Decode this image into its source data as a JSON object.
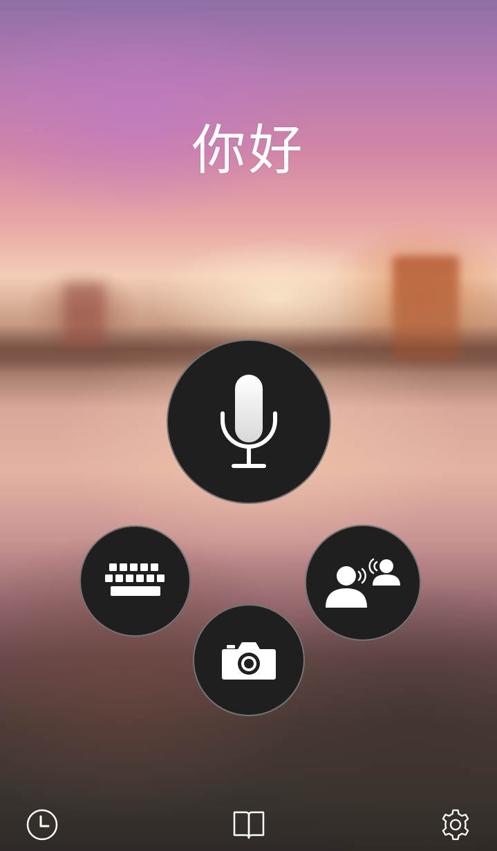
{
  "greeting": {
    "text": "你好"
  },
  "actions": {
    "primary": {
      "name": "microphone",
      "icon": "microphone-icon"
    },
    "secondary": [
      {
        "name": "keyboard",
        "icon": "keyboard-icon"
      },
      {
        "name": "camera",
        "icon": "camera-icon"
      },
      {
        "name": "conversation",
        "icon": "conversation-icon"
      }
    ]
  },
  "bottom_bar": {
    "items": [
      {
        "name": "history",
        "icon": "clock-icon"
      },
      {
        "name": "phrasebook",
        "icon": "book-icon"
      },
      {
        "name": "settings",
        "icon": "gear-icon"
      }
    ]
  },
  "colors": {
    "button_fill": "#1f1f1f",
    "icon": "#ffffff",
    "greeting_text": "#ffffff"
  }
}
